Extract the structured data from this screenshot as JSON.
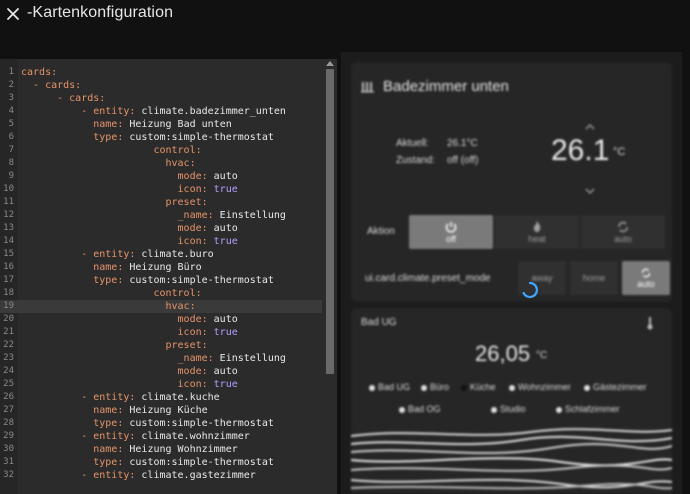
{
  "dialog": {
    "title": "-Kartenkonfiguration"
  },
  "editor": {
    "lines": [
      {
        "n": "1",
        "k": "cards:",
        "v": "",
        "b": ""
      },
      {
        "n": "2",
        "k": "  - cards:",
        "v": "",
        "b": ""
      },
      {
        "n": "3",
        "k": "      - cards:",
        "v": "",
        "b": ""
      },
      {
        "n": "4",
        "k": "          - entity:",
        "v": " climate.badezimmer_unten",
        "b": ""
      },
      {
        "n": "5",
        "k": "            name:",
        "v": " Heizung Bad unten",
        "b": ""
      },
      {
        "n": "6",
        "k": "            type:",
        "v": " custom:simple-thermostat",
        "b": ""
      },
      {
        "n": "7",
        "k": "                      control:",
        "v": "",
        "b": ""
      },
      {
        "n": "8",
        "k": "                        hvac:",
        "v": "",
        "b": ""
      },
      {
        "n": "9",
        "k": "                          mode:",
        "v": " auto",
        "b": ""
      },
      {
        "n": "10",
        "k": "                          icon:",
        "v": "",
        "b": " true"
      },
      {
        "n": "11",
        "k": "                        preset:",
        "v": "",
        "b": ""
      },
      {
        "n": "12",
        "k": "                          _name:",
        "v": " Einstellung",
        "b": ""
      },
      {
        "n": "13",
        "k": "                          mode:",
        "v": " auto",
        "b": ""
      },
      {
        "n": "14",
        "k": "                          icon:",
        "v": "",
        "b": " true"
      },
      {
        "n": "15",
        "k": "          - entity:",
        "v": " climate.buro",
        "b": ""
      },
      {
        "n": "16",
        "k": "            name:",
        "v": " Heizung Büro",
        "b": ""
      },
      {
        "n": "17",
        "k": "            type:",
        "v": " custom:simple-thermostat",
        "b": ""
      },
      {
        "n": "18",
        "k": "                      control:",
        "v": "",
        "b": ""
      },
      {
        "n": "19",
        "k": "                        hvac:",
        "v": "",
        "b": ""
      },
      {
        "n": "20",
        "k": "                          mode:",
        "v": " auto",
        "b": ""
      },
      {
        "n": "21",
        "k": "                          icon:",
        "v": "",
        "b": " true"
      },
      {
        "n": "22",
        "k": "                        preset:",
        "v": "",
        "b": ""
      },
      {
        "n": "23",
        "k": "                          _name:",
        "v": " Einstellung",
        "b": ""
      },
      {
        "n": "24",
        "k": "                          mode:",
        "v": " auto",
        "b": ""
      },
      {
        "n": "25",
        "k": "                          icon:",
        "v": "",
        "b": " true"
      },
      {
        "n": "26",
        "k": "          - entity:",
        "v": " climate.kuche",
        "b": ""
      },
      {
        "n": "27",
        "k": "            name:",
        "v": " Heizung Küche",
        "b": ""
      },
      {
        "n": "28",
        "k": "            type:",
        "v": " custom:simple-thermostat",
        "b": ""
      },
      {
        "n": "29",
        "k": "          - entity:",
        "v": " climate.wohnzimmer",
        "b": ""
      },
      {
        "n": "30",
        "k": "            name:",
        "v": " Heizung Wohnzimmer",
        "b": ""
      },
      {
        "n": "31",
        "k": "            type:",
        "v": " custom:simple-thermostat",
        "b": ""
      },
      {
        "n": "32",
        "k": "          - entity:",
        "v": " climate.gastezimmer",
        "b": ""
      }
    ],
    "active_line": "19"
  },
  "preview": {
    "thermostat": {
      "icon": "radiator-icon",
      "title": "Badezimmer unten",
      "current_label": "Aktuell:",
      "current_value": "26.1°C",
      "state_label": "Zustand:",
      "state_value": "off (off)",
      "target": "26.1",
      "unit": "°C",
      "action_label": "Aktion",
      "hvac_modes": [
        {
          "label": "off",
          "icon": "power-icon",
          "selected": true
        },
        {
          "label": "heat",
          "icon": "flame-icon",
          "selected": false
        },
        {
          "label": "auto",
          "icon": "autorenew-icon",
          "selected": false
        }
      ],
      "preset_label": "ui.card.climate.preset_mode",
      "presets": [
        {
          "label": "away",
          "selected": false
        },
        {
          "label": "home",
          "selected": false
        },
        {
          "label": "auto",
          "selected": true
        }
      ]
    },
    "sensor": {
      "title": "Bad UG",
      "value": "26,05",
      "unit": "°C",
      "legend": [
        "Bad UG",
        "Büro",
        "Küche",
        "Wohnzimmer",
        "Gästezimmer",
        "Bad OG",
        "Studio",
        "Schlafzimmer"
      ]
    }
  },
  "colors": {
    "key": "#e5946a",
    "value": "#e8e8e8",
    "bool": "#b59cff",
    "spinner": "#3ea6ff"
  }
}
